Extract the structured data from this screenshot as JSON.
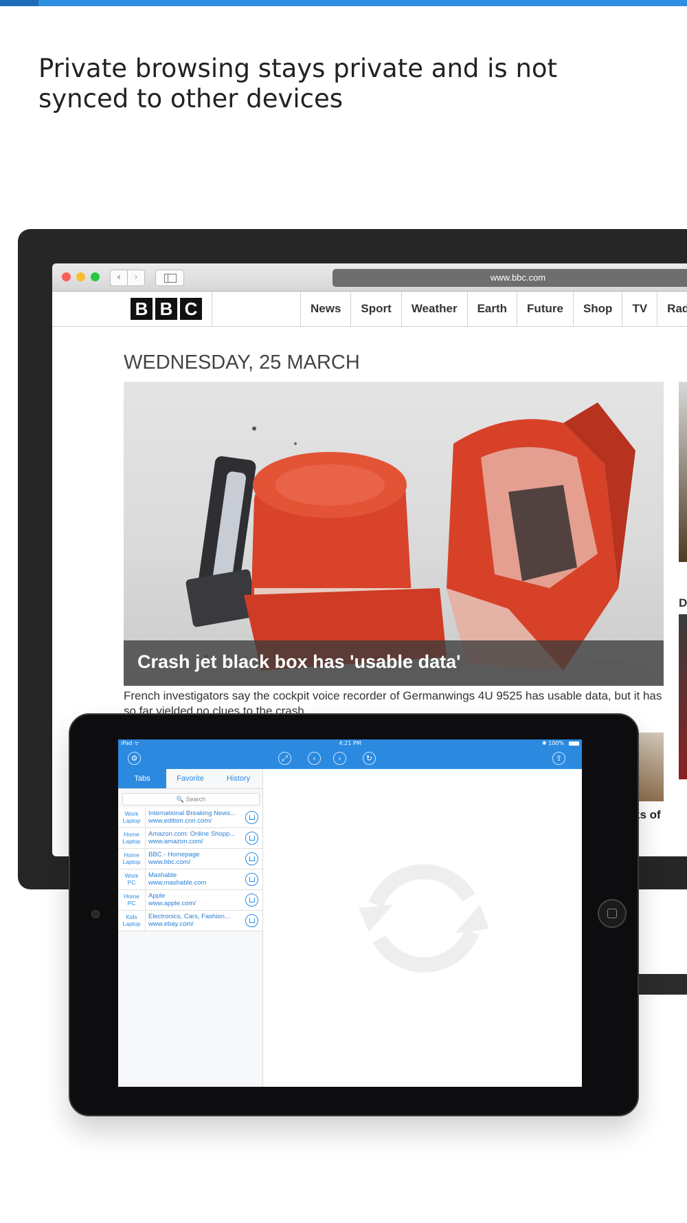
{
  "headline": "Private browsing stays private and is not synced to other devices",
  "browser": {
    "url": "www.bbc.com",
    "nav_back": "‹",
    "nav_forward": "›",
    "logo": [
      "B",
      "B",
      "C"
    ],
    "nav_items": [
      "News",
      "Sport",
      "Weather",
      "Earth",
      "Future",
      "Shop",
      "TV",
      "Rad"
    ],
    "date": "WEDNESDAY, 25 MARCH",
    "hero_caption": "Crash jet black box has 'usable data'",
    "summary": "French investigators say the cockpit voice recorder of Germanwings 4U 9525 has usable data, but it has so far yielded no clues to the crash.",
    "side_letter": "D",
    "side_text": "ks of"
  },
  "ipad": {
    "status_left": "iPad ᯤ",
    "status_time": "4:21 PM",
    "status_right": "✱ 100%",
    "tabs": [
      "Tabs",
      "Favorite",
      "History"
    ],
    "search_placeholder": "🔍 Search",
    "entries": [
      {
        "device": "Work",
        "type": "Laptop",
        "title": "International Breaking News...",
        "url": "www.edition.cnn.com/"
      },
      {
        "device": "Home",
        "type": "Laptop",
        "title": "Amazon.com: Online Shopp...",
        "url": "www.amazon.com/"
      },
      {
        "device": "Home",
        "type": "Laptop",
        "title": "BBC - Homepage",
        "url": "www.bbc.com/"
      },
      {
        "device": "Work",
        "type": "PC",
        "title": "Mashable",
        "url": "www.mashable.com"
      },
      {
        "device": "Home",
        "type": "PC",
        "title": "Apple",
        "url": "www.apple.com/"
      },
      {
        "device": "Kids",
        "type": "Laptop",
        "title": "Electronics, Cars, Fashion...",
        "url": "www.ebay.com/"
      }
    ]
  },
  "colors": {
    "accent": "#2b8ae0",
    "top_bar": "#2f8fe2"
  }
}
